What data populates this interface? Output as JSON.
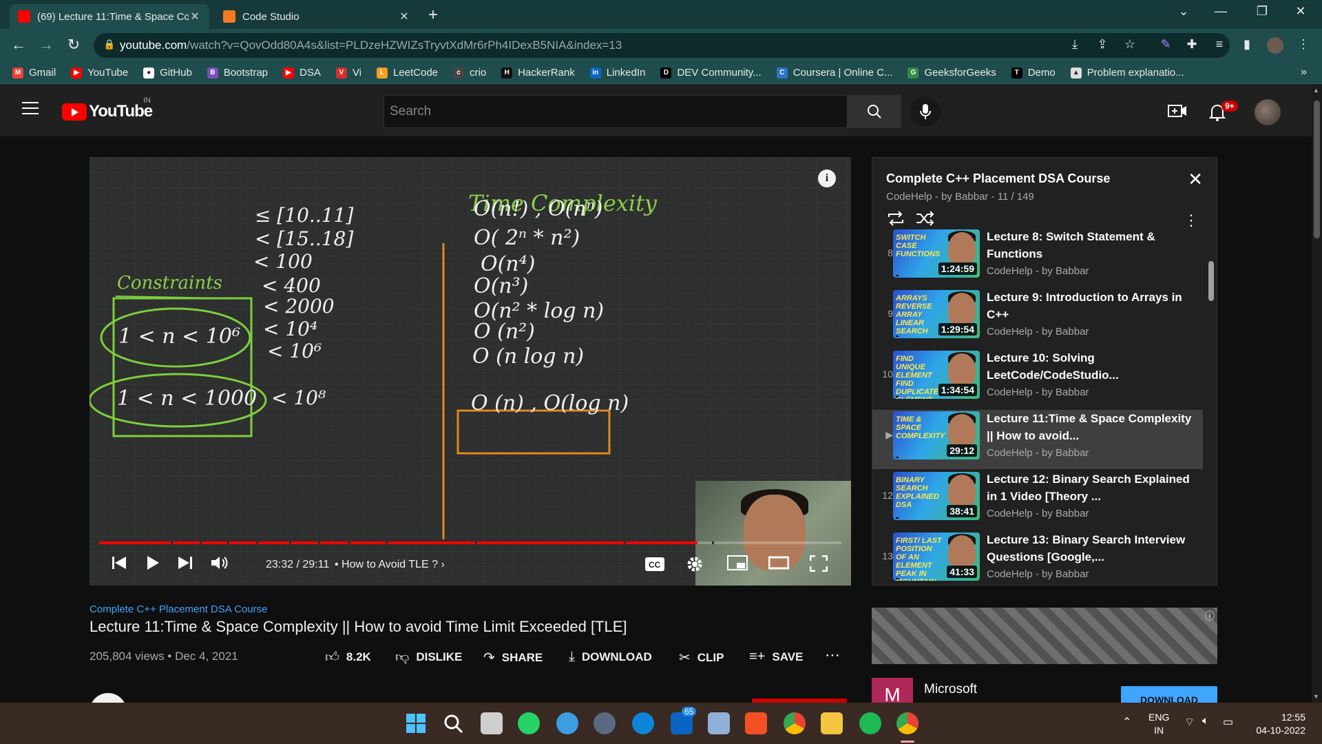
{
  "browser": {
    "tabs": [
      {
        "title": "(69) Lecture 11:Time & Space Co",
        "active": true
      },
      {
        "title": "Code Studio",
        "active": false
      }
    ],
    "url_host": "youtube.com",
    "url_rest": "/watch?v=QovOdd80A4s&list=PLDzeHZWIZsTryvtXdMr6rPh4IDexB5NIA&index=13"
  },
  "bookmarks": [
    {
      "label": "Gmail",
      "color": "#ea4335",
      "glyph": "M"
    },
    {
      "label": "YouTube",
      "color": "#ff0000",
      "glyph": "▶"
    },
    {
      "label": "GitHub",
      "color": "#ffffff",
      "glyph": "●"
    },
    {
      "label": "Bootstrap",
      "color": "#7952b3",
      "glyph": "B"
    },
    {
      "label": "DSA",
      "color": "#ff0000",
      "glyph": "▶"
    },
    {
      "label": "Vi",
      "color": "#d32f2f",
      "glyph": "V"
    },
    {
      "label": "LeetCode",
      "color": "#f89f1b",
      "glyph": "L"
    },
    {
      "label": "crio",
      "color": "#444444",
      "glyph": "c"
    },
    {
      "label": "HackerRank",
      "color": "#111111",
      "glyph": "H"
    },
    {
      "label": "LinkedIn",
      "color": "#0a66c2",
      "glyph": "in"
    },
    {
      "label": "DEV Community...",
      "color": "#000000",
      "glyph": "D"
    },
    {
      "label": "Coursera | Online C...",
      "color": "#2a73cc",
      "glyph": "C"
    },
    {
      "label": "GeeksforGeeks",
      "color": "#2f8d46",
      "glyph": "G"
    },
    {
      "label": "Demo",
      "color": "#000000",
      "glyph": "T"
    },
    {
      "label": "Problem explanatio...",
      "color": "#dddddd",
      "glyph": "▲"
    }
  ],
  "masthead": {
    "logo_word": "YouTube",
    "region": "IN",
    "search_placeholder": "Search",
    "notifications": "9+"
  },
  "player": {
    "time": "23:32 / 29:11",
    "chapter": "• How to Avoid TLE ?",
    "progress_fraction": 0.806
  },
  "video": {
    "playlist_link": "Complete C++ Placement DSA Course",
    "title": "Lecture 11:Time & Space Complexity || How to avoid Time Limit Exceeded [TLE]",
    "stats": "205,804 views • Dec 4, 2021",
    "actions": {
      "like": "8.2K",
      "dislike": "DISLIKE",
      "share": "SHARE",
      "download": "DOWNLOAD",
      "clip": "CLIP",
      "save": "SAVE"
    }
  },
  "playlist": {
    "title": "Complete C++ Placement DSA Course",
    "subtitle": "CodeHelp - by Babbar - 11 / 149",
    "items": [
      {
        "index": "8",
        "title": "Lecture 8: Switch Statement & Functions",
        "channel": "CodeHelp - by Babbar",
        "duration": "1:24:59",
        "thumb_text": "SWITCH CASE FUNCTIONS",
        "current": false
      },
      {
        "index": "9",
        "title": "Lecture 9: Introduction to Arrays in C++",
        "channel": "CodeHelp - by Babbar",
        "duration": "1:29:54",
        "thumb_text": "ARRAYS REVERSE ARRAY LINEAR SEARCH",
        "current": false
      },
      {
        "index": "10",
        "title": "Lecture 10: Solving LeetCode/CodeStudio...",
        "channel": "CodeHelp - by Babbar",
        "duration": "1:34:54",
        "thumb_text": "FIND UNIQUE ELEMENT FIND DUPLICATE ELEMENT ARRAY INTERSECTION",
        "current": false
      },
      {
        "index": "▶",
        "title": "Lecture 11:Time & Space Complexity || How to avoid...",
        "channel": "CodeHelp - by Babbar",
        "duration": "29:12",
        "thumb_text": "TIME & SPACE COMPLEXITY",
        "current": true
      },
      {
        "index": "12",
        "title": "Lecture 12: Binary Search Explained in 1 Video [Theory ...",
        "channel": "CodeHelp - by Babbar",
        "duration": "38:41",
        "thumb_text": "BINARY SEARCH EXPLAINED DSA",
        "current": false
      },
      {
        "index": "13",
        "title": "Lecture 13: Binary Search Interview Questions [Google,...",
        "channel": "CodeHelp - by Babbar",
        "duration": "41:33",
        "thumb_text": "FIRST/ LAST POSITION OF AN ELEMENT PEAK IN MOUNTAIN ARRAY & MORE",
        "current": false
      }
    ]
  },
  "ad": {
    "advertiser": "Microsoft",
    "logo_letter": "M",
    "cta": "DOWNLOAD"
  },
  "board": {
    "heading": "Time Complexity",
    "constraints_label": "Constraints",
    "constraint_1": "1 < n < 10⁶",
    "constraint_2": "1 < n < 1000",
    "left_col": [
      "≤ [10..11]",
      "< [15..18]",
      "< 100",
      "< 400",
      "< 2000",
      "< 10⁴",
      "< 10⁶",
      "< 10⁸"
    ],
    "right_col": [
      "O(n!) , O(nⁿ)",
      "O( 2ⁿ * n²)",
      "O(n⁴)",
      "O(n³)",
      "O(n² * log n)",
      "O (n²)",
      "O (n log n)",
      "O (n) , O(log n)"
    ]
  },
  "taskbar": {
    "lang_1": "ENG",
    "lang_2": "IN",
    "time": "12:55",
    "date": "04-10-2022",
    "mail_badge": "65"
  }
}
